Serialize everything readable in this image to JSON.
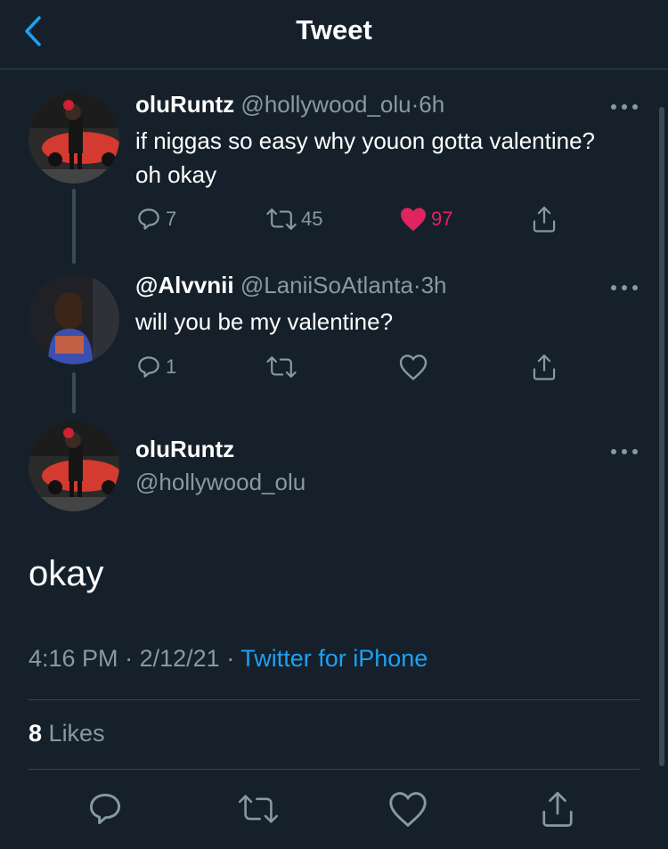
{
  "header": {
    "title": "Tweet",
    "back_icon": "chevron-left-icon"
  },
  "colors": {
    "background": "#15202b",
    "accent": "#1da1f2",
    "like": "#e0245e",
    "muted": "#8899a6",
    "divider": "#38444d"
  },
  "thread": [
    {
      "name": "oluRuntz",
      "handle": "@hollywood_olu",
      "dot": "·",
      "time": "6h",
      "text": "if niggas so easy why youon gotta valentine? oh okay",
      "replies": "7",
      "retweets": "45",
      "likes": "97",
      "liked": true
    },
    {
      "name": "@Alvvnii",
      "handle": "@LaniiSoAtlanta",
      "dot": "·",
      "time": "3h",
      "text": "will you be my valentine?",
      "replies": "1",
      "retweets": "",
      "likes": "",
      "liked": false
    }
  ],
  "main_tweet": {
    "name": "oluRuntz",
    "handle": "@hollywood_olu",
    "text": "okay",
    "time": "4:16 PM",
    "sep1": "·",
    "date": "2/12/21",
    "sep2": "·",
    "source": "Twitter for iPhone",
    "like_count": "8",
    "like_label": "Likes"
  }
}
